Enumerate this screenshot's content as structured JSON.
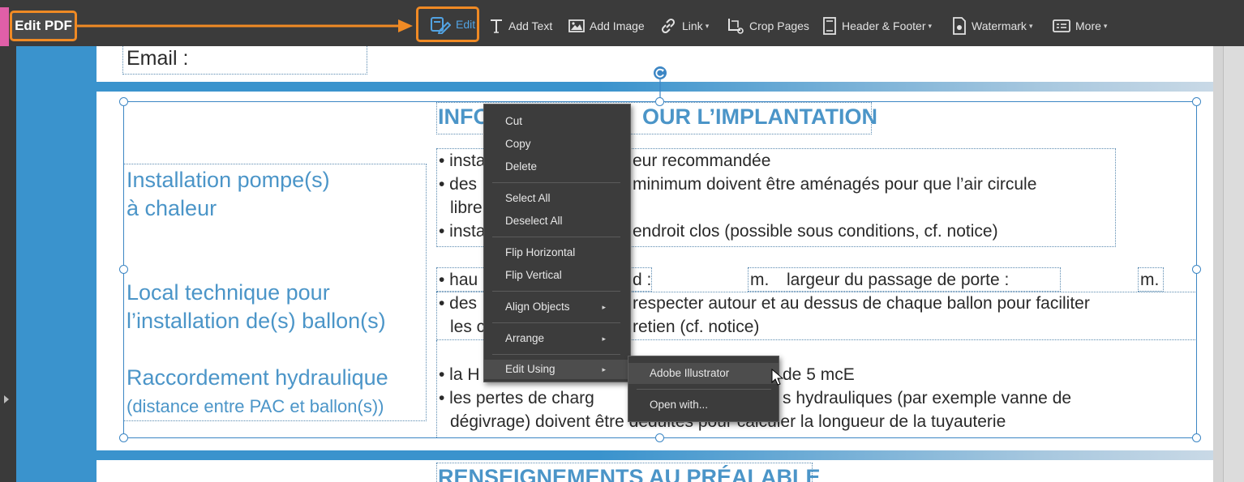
{
  "toolbar": {
    "title": "Edit PDF",
    "edit_label": "Edit",
    "add_text_label": "Add Text",
    "add_image_label": "Add Image",
    "link_label": "Link",
    "crop_pages_label": "Crop Pages",
    "header_footer_label": "Header & Footer",
    "watermark_label": "Watermark",
    "more_label": "More",
    "caret": "▾"
  },
  "document": {
    "email_label": "Email :",
    "section_heading_partial": "INFO",
    "section_heading_rest": "OUR L’IMPLANTATION",
    "left_installation_line1": "Installation pompe(s)",
    "left_installation_line2": "à chaleur",
    "left_local_line1": "Local technique pour",
    "left_local_line2": "l’installation de(s) ballon(s)",
    "left_raccord_line1": "Raccordement hydraulique",
    "left_raccord_line2": "(distance entre PAC et ballon(s))",
    "b1_start": "• insta",
    "b1_end": "eur recommandée",
    "b2_start": "• des",
    "b2_end": "minimum doivent être aménagés pour que l’air circule",
    "b2_cont": "libre",
    "b3_start": "• insta",
    "b3_end": "endroit clos (possible sous conditions, cf. notice)",
    "b4_start": "• hau",
    "b4_mid": "d :",
    "b4_unit1": "m.",
    "b4_label2": "largeur du passage de porte :",
    "b4_unit2": "m.",
    "b5_start": "• des",
    "b5_end": "respecter autour et au dessus de chaque ballon pour faciliter",
    "b5_cont_start": "les c",
    "b5_cont_end": "retien (cf. notice)",
    "b6_start": "• la H",
    "b6_end": "de 5 mcE",
    "b7_start": "• les pertes de charg",
    "b7_end": "s hydrauliques (par exemple vanne de",
    "b7_cont": "dégivrage) doivent être déduites pour calculer la longueur de la tuyauterie",
    "bottom_heading": "RENSEIGNEMENTS AU PRÉALABLE"
  },
  "context_menu": {
    "cut": "Cut",
    "copy": "Copy",
    "delete": "Delete",
    "select_all": "Select All",
    "deselect_all": "Deselect All",
    "flip_horizontal": "Flip Horizontal",
    "flip_vertical": "Flip Vertical",
    "align_objects": "Align Objects",
    "arrange": "Arrange",
    "edit_using": "Edit Using",
    "submenu_arrow": "▸"
  },
  "submenu": {
    "adobe_illustrator": "Adobe Illustrator",
    "open_with": "Open with..."
  },
  "colors": {
    "accent_orange": "#f08a24",
    "edit_blue": "#52a3e3",
    "doc_blue": "#4b95c8",
    "selection_blue": "#3c86c4"
  }
}
